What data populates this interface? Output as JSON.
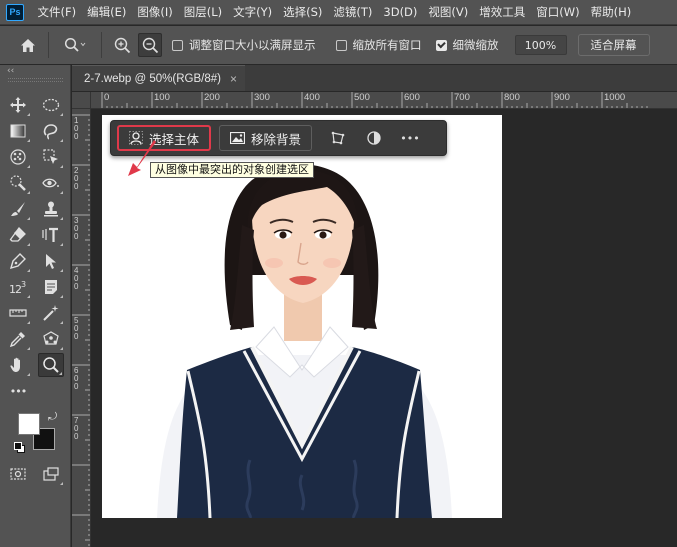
{
  "menubar": {
    "logo": "Ps",
    "items": [
      "文件(F)",
      "编辑(E)",
      "图像(I)",
      "图层(L)",
      "文字(Y)",
      "选择(S)",
      "滤镜(T)",
      "3D(D)",
      "视图(V)",
      "增效工具",
      "窗口(W)",
      "帮助(H)"
    ]
  },
  "options": {
    "resize_windows_label": "调整窗口大小以满屏显示",
    "resize_windows_checked": false,
    "zoom_all_label": "缩放所有窗口",
    "zoom_all_checked": false,
    "scrubby_zoom_label": "细微缩放",
    "scrubby_zoom_checked": true,
    "zoom_value": "100%",
    "fit_screen_label": "适合屏幕"
  },
  "toolbar": {
    "collapse": "‹‹",
    "more": "•••"
  },
  "document": {
    "tab_title": "2-7.webp @ 50%(RGB/8#)",
    "tab_close": "×",
    "ruler_top_labels": [
      "0",
      "100",
      "200",
      "300",
      "400",
      "500",
      "600",
      "700",
      "800",
      "900",
      "1000"
    ],
    "ruler_left_labels": [
      "1",
      "0",
      "0",
      "2",
      "0",
      "0",
      "3",
      "0",
      "0",
      "4",
      "0",
      "0",
      "5",
      "0",
      "0",
      "6",
      "0",
      "0",
      "7",
      "0",
      "0"
    ]
  },
  "taskbar": {
    "select_subject_label": "选择主体",
    "remove_background_label": "移除背景",
    "more": "•••"
  },
  "tooltip": {
    "text": "从图像中最突出的对象创建选区"
  },
  "colors": {
    "accent_highlight": "#e0394a",
    "ps_blue": "#31a8ff",
    "vest_navy": "#1c2a44"
  }
}
